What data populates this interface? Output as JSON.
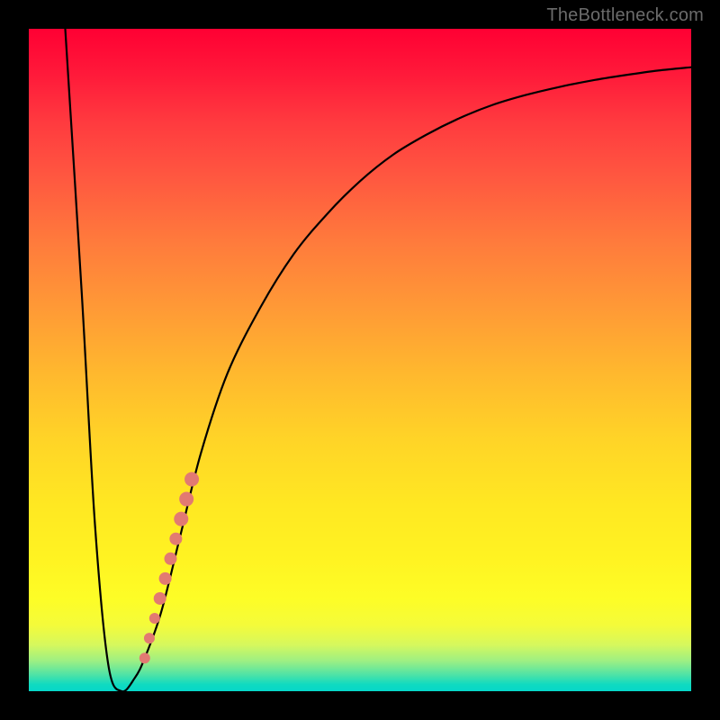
{
  "attribution": "TheBottleneck.com",
  "chart_data": {
    "type": "line",
    "title": "",
    "xlabel": "",
    "ylabel": "",
    "xlim": [
      0,
      100
    ],
    "ylim": [
      0,
      100
    ],
    "series": [
      {
        "name": "bottleneck-curve",
        "x": [
          5.5,
          8,
          10,
          12,
          14,
          16,
          17.5,
          20,
          23,
          26,
          30,
          35,
          40,
          45,
          50,
          55,
          60,
          65,
          70,
          75,
          80,
          85,
          90,
          95,
          100
        ],
        "y": [
          100,
          60,
          25,
          4,
          0,
          2,
          5,
          12,
          24,
          36,
          48,
          58,
          66,
          72,
          77,
          81,
          84,
          86.5,
          88.5,
          90,
          91.2,
          92.2,
          93,
          93.7,
          94.2
        ]
      }
    ],
    "markers": {
      "name": "highlight-dots",
      "color": "#e27a72",
      "points": [
        {
          "x": 17.5,
          "y": 5,
          "r": 6
        },
        {
          "x": 18.2,
          "y": 8,
          "r": 6
        },
        {
          "x": 19.0,
          "y": 11,
          "r": 6
        },
        {
          "x": 19.8,
          "y": 14,
          "r": 7
        },
        {
          "x": 20.6,
          "y": 17,
          "r": 7
        },
        {
          "x": 21.4,
          "y": 20,
          "r": 7
        },
        {
          "x": 22.2,
          "y": 23,
          "r": 7
        },
        {
          "x": 23.0,
          "y": 26,
          "r": 8
        },
        {
          "x": 23.8,
          "y": 29,
          "r": 8
        },
        {
          "x": 24.6,
          "y": 32,
          "r": 8
        }
      ]
    },
    "gradient_stops": [
      {
        "pct": 0,
        "color": "#ff0033"
      },
      {
        "pct": 50,
        "color": "#ffcc22"
      },
      {
        "pct": 88,
        "color": "#fcfc2a"
      },
      {
        "pct": 100,
        "color": "#06d7c8"
      }
    ]
  }
}
